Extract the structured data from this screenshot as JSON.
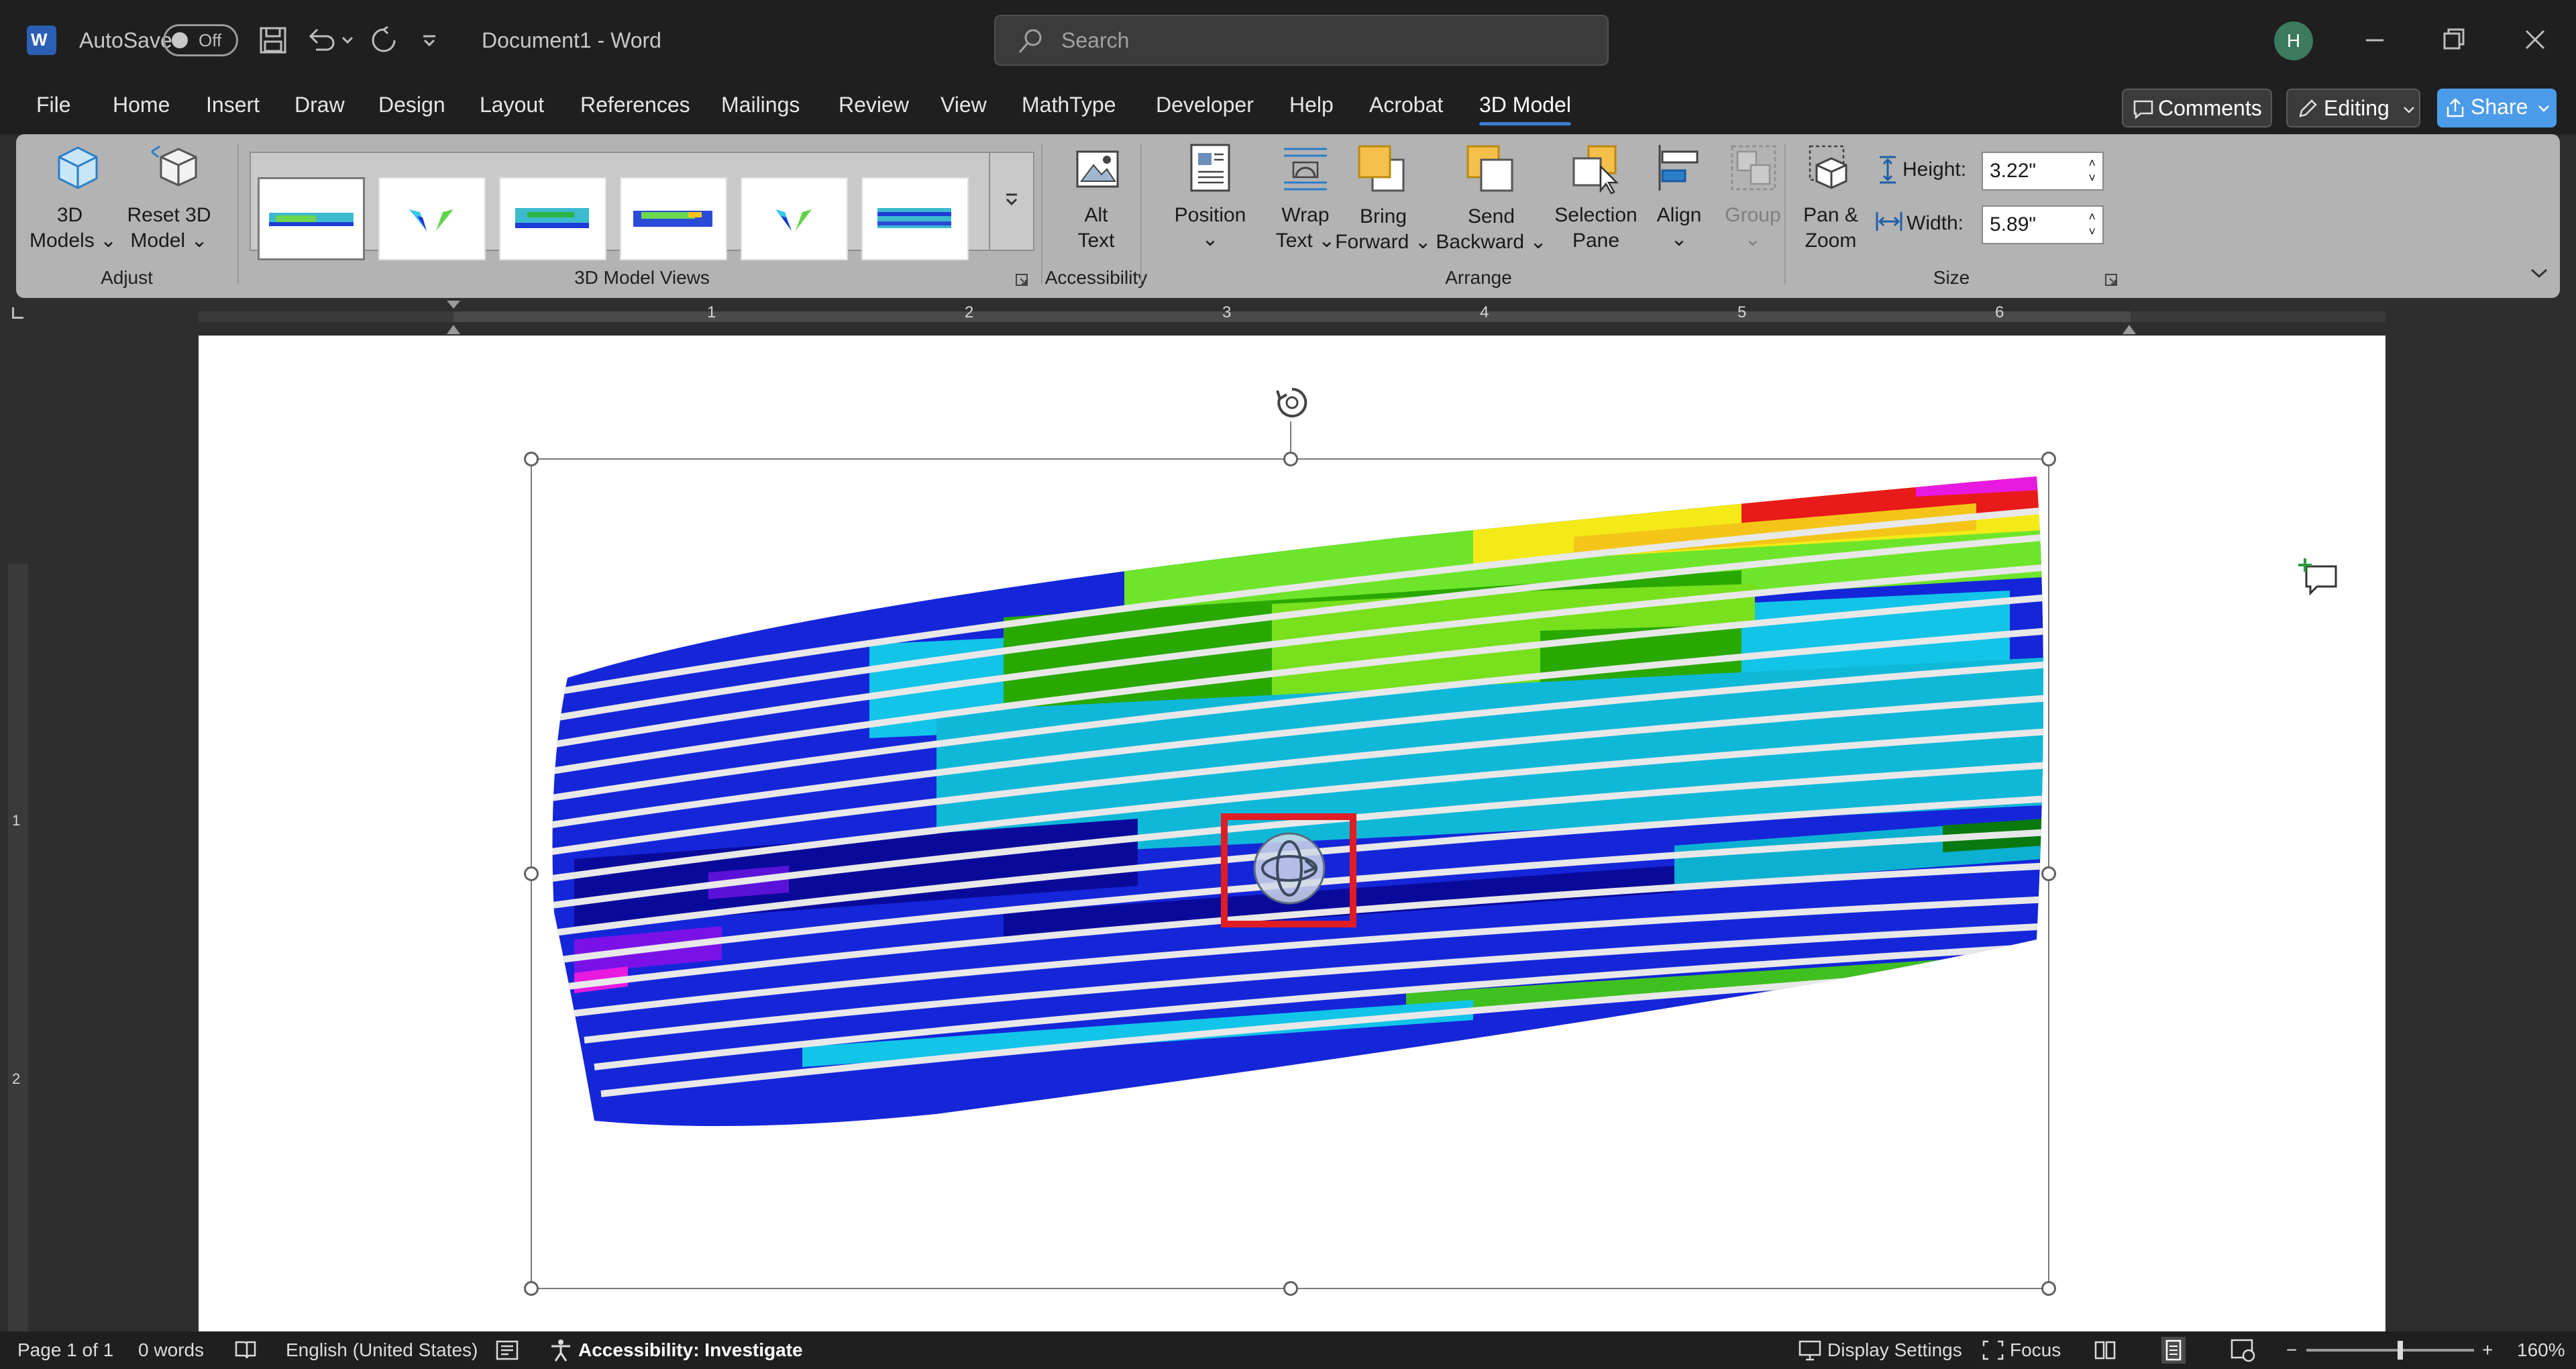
{
  "title_bar": {
    "autosave_label": "AutoSave",
    "autosave_state": "Off",
    "document_title": "Document1  -  Word",
    "search_placeholder": "Search",
    "user_initial": "H"
  },
  "tabs": [
    "File",
    "Home",
    "Insert",
    "Draw",
    "Design",
    "Layout",
    "References",
    "Mailings",
    "Review",
    "View",
    "MathType",
    "Developer",
    "Help",
    "Acrobat",
    "3D Model"
  ],
  "active_tab": "3D Model",
  "top_right": {
    "comments": "Comments",
    "editing": "Editing",
    "share": "Share"
  },
  "ribbon": {
    "adjust": {
      "models_line1": "3D",
      "models_line2": "Models",
      "reset_line1": "Reset 3D",
      "reset_line2": "Model",
      "group_label": "Adjust"
    },
    "views_group_label": "3D Model Views",
    "accessibility": {
      "line1": "Alt",
      "line2": "Text",
      "group_label": "Accessibility"
    },
    "arrange": {
      "position": "Position",
      "wrap_line1": "Wrap",
      "wrap_line2": "Text",
      "bring_line1": "Bring",
      "bring_line2": "Forward",
      "send_line1": "Send",
      "send_line2": "Backward",
      "selection_line1": "Selection",
      "selection_line2": "Pane",
      "align": "Align",
      "group": "Group",
      "group_label": "Arrange"
    },
    "size": {
      "pan_line1": "Pan &",
      "pan_line2": "Zoom",
      "height_label": "Height:",
      "height_value": "3.22\"",
      "width_label": "Width:",
      "width_value": "5.89\"",
      "group_label": "Size"
    }
  },
  "ruler_numbers": [
    "1",
    "2",
    "3",
    "4",
    "5",
    "6"
  ],
  "vruler_numbers": [
    "1",
    "2"
  ],
  "status_bar": {
    "page": "Page 1 of 1",
    "words": "0 words",
    "language": "English (United States)",
    "accessibility": "Accessibility: Investigate",
    "display_settings": "Display Settings",
    "focus": "Focus",
    "zoom": "160%"
  },
  "colors": {
    "accent": "#3a7ecf",
    "highlight_box": "#e01c24",
    "share_button": "#4c9be8"
  }
}
